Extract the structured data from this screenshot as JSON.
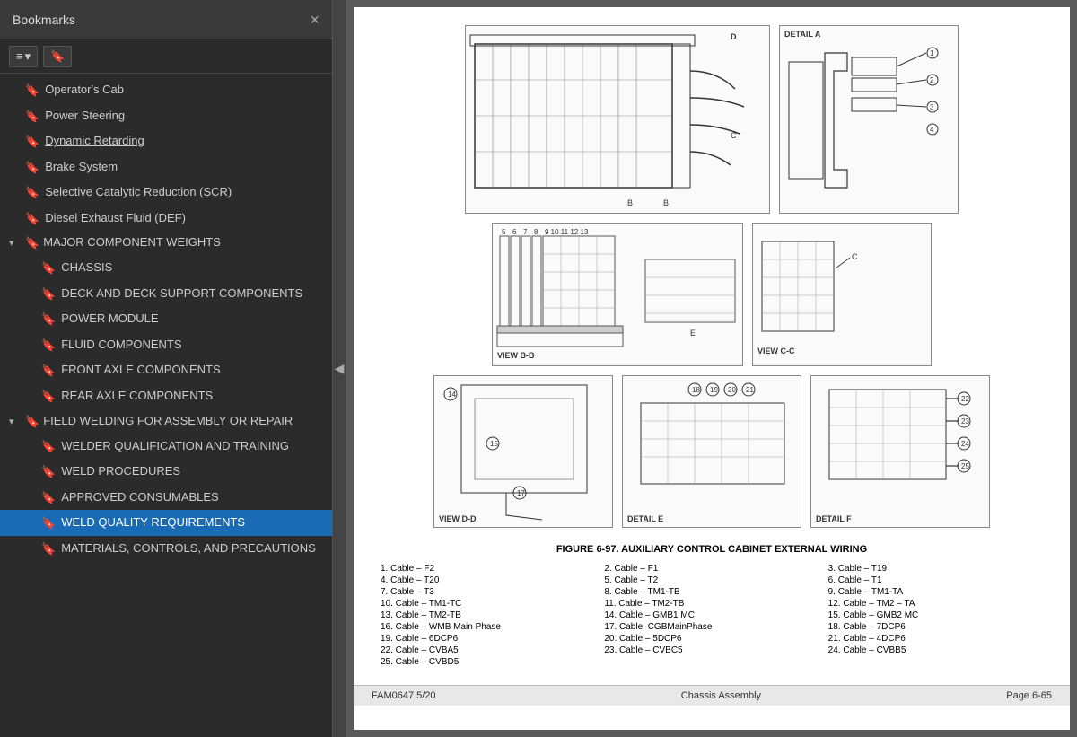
{
  "sidebar": {
    "title": "Bookmarks",
    "close_label": "×",
    "toolbar": {
      "btn1_label": "≡▾",
      "btn2_label": "🔖"
    },
    "items": [
      {
        "id": "operators-cab",
        "label": "Operator's Cab",
        "indent": 1,
        "has_icon": true,
        "active": false
      },
      {
        "id": "power-steering",
        "label": "Power Steering",
        "indent": 1,
        "has_icon": true,
        "active": false
      },
      {
        "id": "dynamic-retarding",
        "label": "Dynamic Retarding",
        "indent": 1,
        "has_icon": true,
        "active": false,
        "underline": true
      },
      {
        "id": "brake-system",
        "label": "Brake System",
        "indent": 1,
        "has_icon": true,
        "active": false
      },
      {
        "id": "scr",
        "label": "Selective Catalytic Reduction (SCR)",
        "indent": 1,
        "has_icon": true,
        "active": false
      },
      {
        "id": "def",
        "label": "Diesel Exhaust Fluid (DEF)",
        "indent": 1,
        "has_icon": true,
        "active": false
      },
      {
        "id": "major-component-weights-section",
        "label": "MAJOR COMPONENT WEIGHTS",
        "indent": 0,
        "is_section": true,
        "expanded": true
      },
      {
        "id": "chassis",
        "label": "CHASSIS",
        "indent": 2,
        "has_icon": true,
        "active": false
      },
      {
        "id": "deck-support",
        "label": "DECK AND DECK SUPPORT COMPONENTS",
        "indent": 2,
        "has_icon": true,
        "active": false
      },
      {
        "id": "power-module",
        "label": "POWER MODULE",
        "indent": 2,
        "has_icon": true,
        "active": false
      },
      {
        "id": "fluid-components",
        "label": "FLUID COMPONENTS",
        "indent": 2,
        "has_icon": true,
        "active": false
      },
      {
        "id": "front-axle",
        "label": "FRONT AXLE COMPONENTS",
        "indent": 2,
        "has_icon": true,
        "active": false
      },
      {
        "id": "rear-axle",
        "label": "REAR AXLE COMPONENTS",
        "indent": 2,
        "has_icon": true,
        "active": false
      },
      {
        "id": "field-welding-section",
        "label": "FIELD WELDING FOR ASSEMBLY OR REPAIR",
        "indent": 0,
        "is_section": true,
        "expanded": true
      },
      {
        "id": "welder-qual",
        "label": "WELDER QUALIFICATION AND TRAINING",
        "indent": 2,
        "has_icon": true,
        "active": false
      },
      {
        "id": "weld-procedures",
        "label": "WELD PROCEDURES",
        "indent": 2,
        "has_icon": true,
        "active": false
      },
      {
        "id": "approved-consumables",
        "label": "APPROVED CONSUMABLES",
        "indent": 2,
        "has_icon": true,
        "active": false
      },
      {
        "id": "weld-quality",
        "label": "WELD QUALITY REQUIREMENTS",
        "indent": 2,
        "has_icon": true,
        "active": true
      },
      {
        "id": "materials-controls",
        "label": "MATERIALS, CONTROLS, AND PRECAUTIONS",
        "indent": 2,
        "has_icon": true,
        "active": false
      }
    ]
  },
  "page": {
    "figure_caption": "FIGURE 6-97. AUXILIARY CONTROL CABINET EXTERNAL WIRING",
    "legend": [
      "1. Cable – F2",
      "2. Cable – F1",
      "3. Cable – T19",
      "4. Cable – T20",
      "5. Cable – T2",
      "6. Cable – T1",
      "7. Cable – T3",
      "8. Cable – TM1-TB",
      "9. Cable – TM1-TA",
      "10. Cable – TM1-TC",
      "11. Cable – TM2-TB",
      "12. Cable – TM2 – TA",
      "13. Cable – TM2-TB",
      "14. Cable – GMB1 MC",
      "15. Cable – GMB2 MC",
      "16. Cable – WMB Main Phase",
      "17. Cable–CGBMainPhase",
      "18. Cable – 7DCP6",
      "19. Cable – 6DCP6",
      "20. Cable – 5DCP6",
      "21. Cable – 4DCP6",
      "22. Cable – CVBA5",
      "23. Cable – CVBC5",
      "24. Cable – CVBB5",
      "25. Cable – CVBD5"
    ],
    "footer": {
      "left": "FAM0647  5/20",
      "center": "Chassis Assembly",
      "right": "Page 6-65"
    },
    "diagrams": [
      {
        "id": "main-top",
        "label": "DETAIL A",
        "position": "top-right"
      },
      {
        "id": "view-bb",
        "label": "VIEW B-B"
      },
      {
        "id": "view-cc",
        "label": "VIEW C-C"
      },
      {
        "id": "view-dd",
        "label": "VIEW D-D"
      },
      {
        "id": "detail-e",
        "label": "DETAIL E"
      },
      {
        "id": "detail-f",
        "label": "DETAIL F"
      }
    ]
  },
  "collapse_handle_label": "◀"
}
